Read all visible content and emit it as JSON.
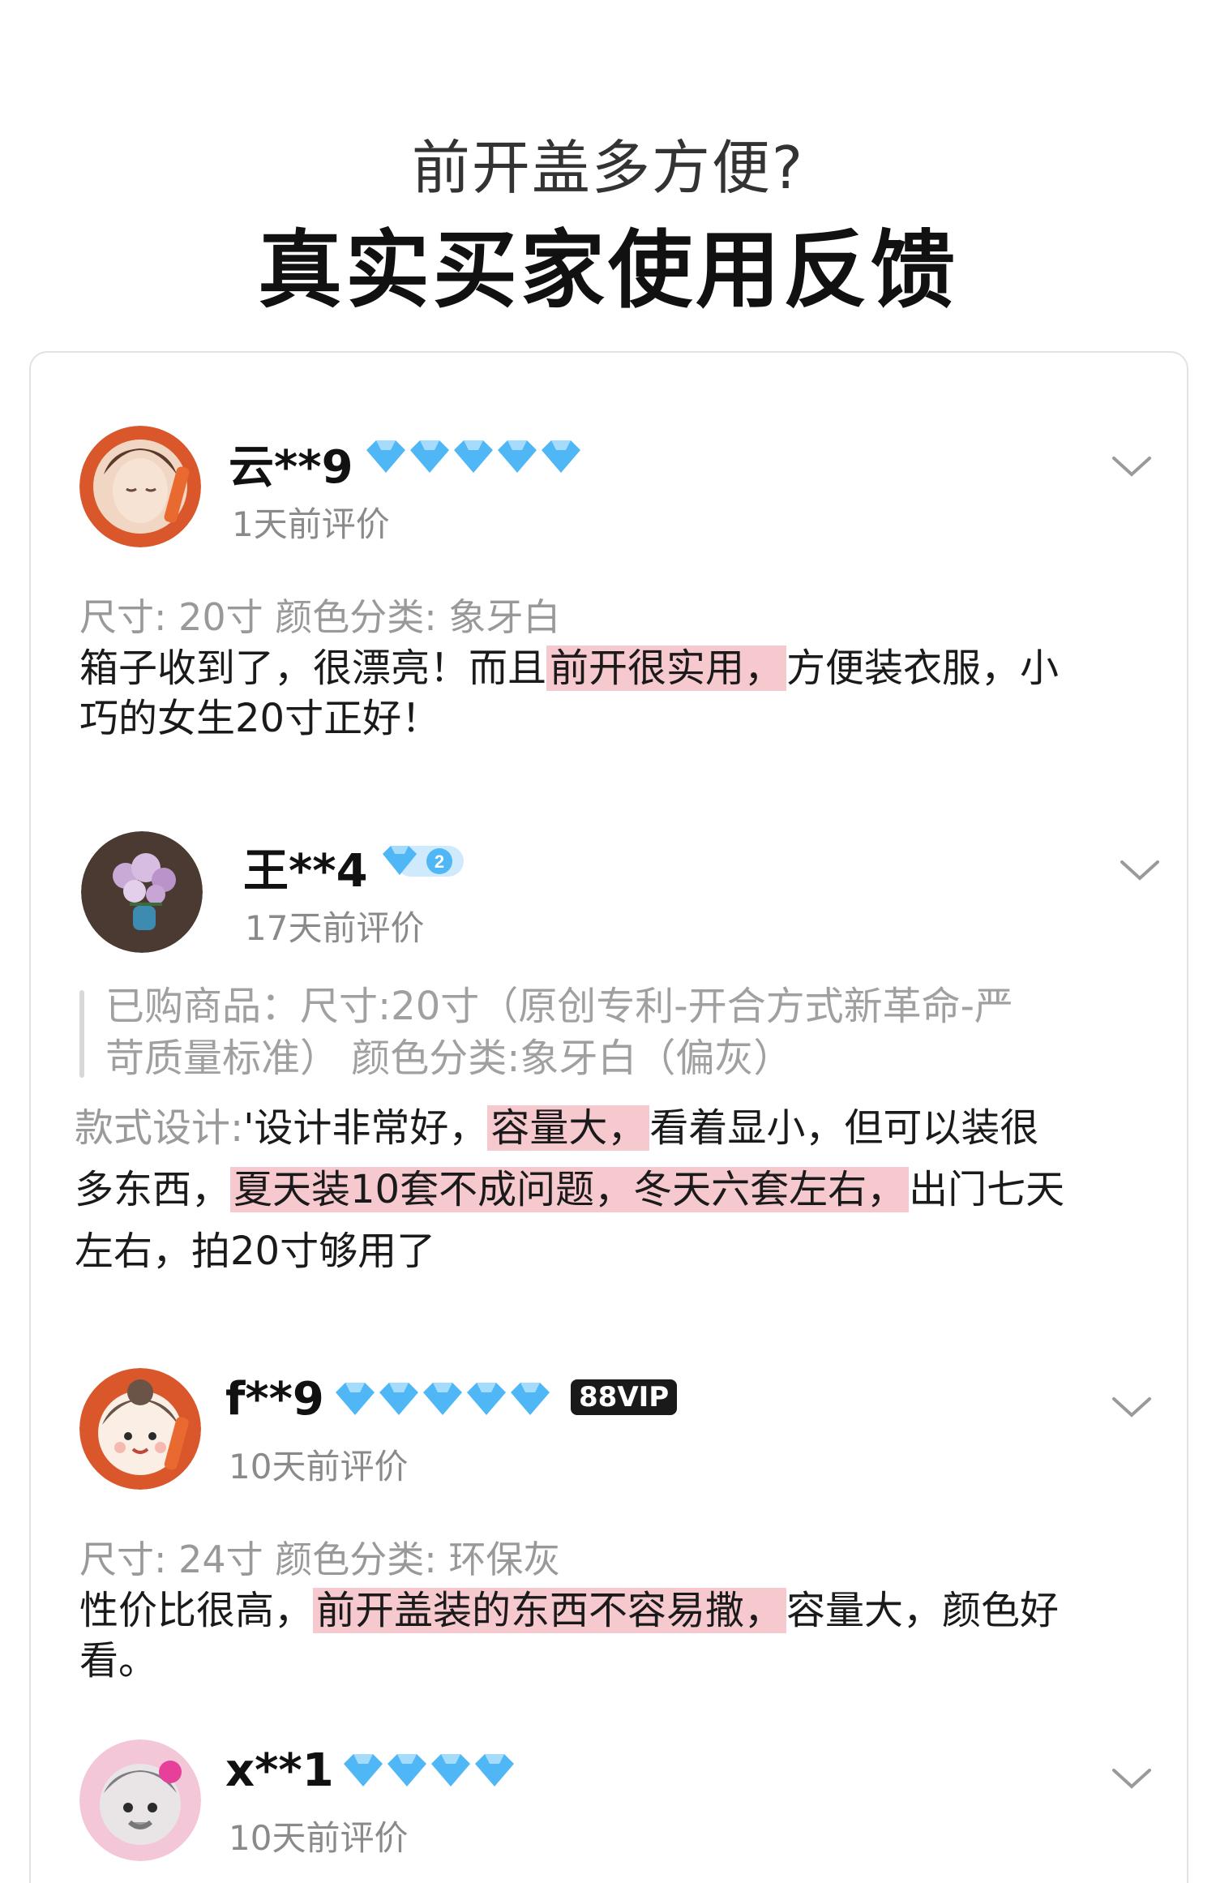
{
  "header": {
    "subtitle": "前开盖多方便?",
    "headline": "真实买家使用反馈"
  },
  "reviews": [
    {
      "name": "云**9",
      "time": "1天前评价",
      "diamonds": 5,
      "meta": "尺寸: 20寸 颜色分类: 象牙白",
      "text_a": "箱子收到了，很漂亮！而且",
      "text_hl": "前开很实用，",
      "text_b": "方便装衣服，小",
      "text_c": "巧的女生20寸正好！"
    },
    {
      "name": "王**4",
      "time": "17天前评价",
      "level": "2",
      "purchased_1": "已购商品：尺寸:20寸（原创专利-开合方式新革命-严",
      "purchased_2": "苛质量标准）  颜色分类:象牙白（偏灰）",
      "style_label": "款式设计:",
      "text_a": "'设计非常好，",
      "text_hl1": "容量大，",
      "text_b": "看着显小，但可以装很",
      "text_c": "多东西，",
      "text_hl2": "夏天装10套不成问题，冬天六套左右，",
      "text_d": "出门七天",
      "text_e": "左右，拍20寸够用了"
    },
    {
      "name": "f**9",
      "time": "10天前评价",
      "diamonds": 5,
      "vip": "88VIP",
      "meta": "尺寸: 24寸 颜色分类: 环保灰",
      "text_a": "性价比很高，",
      "text_hl": "前开盖装的东西不容易撒，",
      "text_b": "容量大，颜色好",
      "text_c": "看。"
    },
    {
      "name": "x**1",
      "time": "10天前评价",
      "diamonds": 4
    }
  ],
  "colors": {
    "highlight": "#f6c9cf",
    "diamond": "#4fb7f5",
    "muted": "#8a8a8a"
  },
  "icons": {
    "chevron": "chevron-down-icon",
    "diamond": "diamond-icon"
  }
}
